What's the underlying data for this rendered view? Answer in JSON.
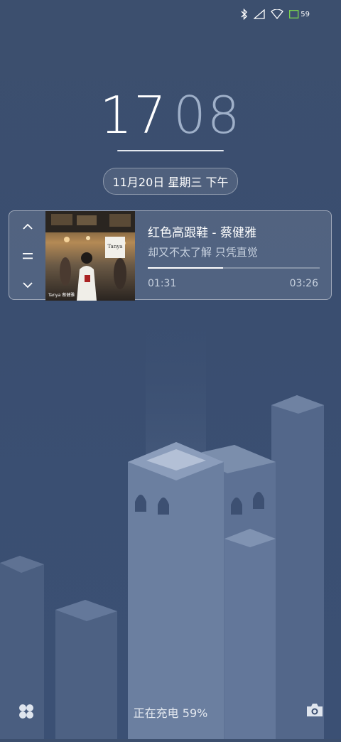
{
  "status": {
    "battery_level": "59",
    "icons": [
      "bluetooth-icon",
      "signal-icon",
      "wifi-icon",
      "battery-icon"
    ]
  },
  "clock": {
    "hours": "17",
    "minutes": "08"
  },
  "date": {
    "text": "11月20日 星期三 下午"
  },
  "music": {
    "title": "红色高跟鞋 - 蔡健雅",
    "lyric": "却又不太了解 只凭直觉",
    "elapsed": "01:31",
    "total": "03:26",
    "progress": 0.44,
    "cover_text": "Tanya",
    "cover_subtitle": "Tanya 蔡健雅"
  },
  "bottom": {
    "charging_text": "正在充电 59%"
  },
  "colors": {
    "accent": "#ffffff",
    "background": "#3b4f71"
  }
}
